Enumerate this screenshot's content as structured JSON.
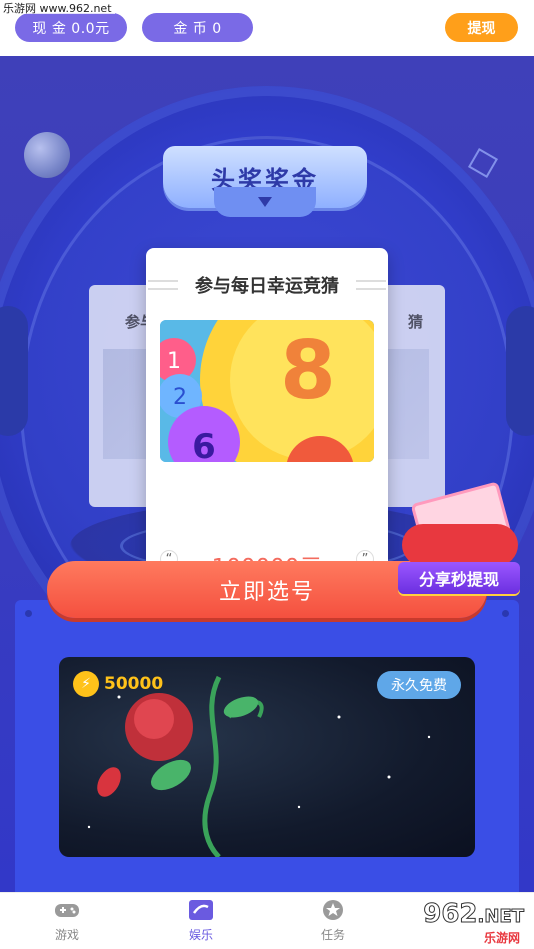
{
  "watermark": "乐游网 www.962.net",
  "header": {
    "cash_label": "现 金 0.0元",
    "coin_label": "金 币 0",
    "withdraw_label": "提现"
  },
  "banner": {
    "title": "头奖奖金"
  },
  "cards": {
    "left_ghost_title": "参与",
    "right_ghost_title": "猜",
    "main_title": "参与每日幸运竞猜",
    "prize": "100000元",
    "image_numbers": [
      "8",
      "2",
      "1",
      "6"
    ]
  },
  "cta_label": "立即选号",
  "share_label": "分享秒提现",
  "game_card": {
    "coins": "50000",
    "tag": "永久免费"
  },
  "tabbar": {
    "tabs": [
      {
        "label": "游戏",
        "icon": "gamepad-icon",
        "active": false
      },
      {
        "label": "娱乐",
        "icon": "entertainment-icon",
        "active": true
      },
      {
        "label": "任务",
        "icon": "star-icon",
        "active": false
      }
    ]
  },
  "logo": {
    "number": "962",
    "net": ".NET",
    "subtitle": "乐游网"
  },
  "colors": {
    "accent_purple": "#7a6ae6",
    "withdraw_orange": "#ff9f1a",
    "cta_red": "#f4503f",
    "prize_red": "#f36b5e",
    "panel_blue": "#3a4ee6"
  }
}
